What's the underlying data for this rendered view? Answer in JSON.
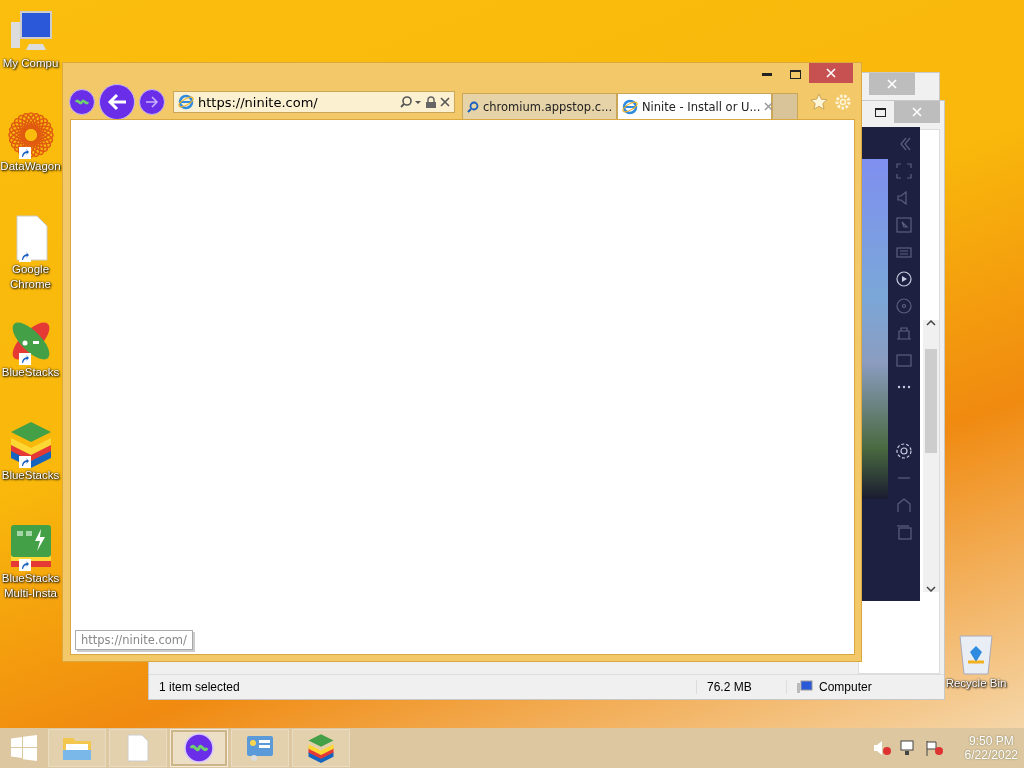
{
  "desktop_icons": [
    {
      "label": "My Compu",
      "kind": "computer",
      "shortcut": false
    },
    {
      "label": "DataWagon",
      "kind": "star",
      "shortcut": true
    },
    {
      "label": "Google Chrome",
      "kind": "file",
      "shortcut": true
    },
    {
      "label": "BlueStacks",
      "kind": "cross",
      "shortcut": true
    },
    {
      "label": "BlueStacks",
      "kind": "stack",
      "shortcut": true
    },
    {
      "label": "BlueStacks Multi-Insta",
      "kind": "multi",
      "shortcut": true
    }
  ],
  "recycle_bin": {
    "label": "Recycle Bin"
  },
  "explorer": {
    "status": "1 item selected",
    "size": "76.2 MB",
    "location": "Computer"
  },
  "browser": {
    "address": "https://ninite.com/",
    "tabs": [
      {
        "label": "chromium.appstop.c...",
        "kind": "search",
        "selected": false
      },
      {
        "label": "Ninite - Install or U...",
        "kind": "ie",
        "selected": true
      }
    ],
    "status_url": "https://ninite.com/"
  },
  "taskbar": {
    "buttons": [
      {
        "kind": "explorer",
        "selected": false
      },
      {
        "kind": "file",
        "selected": false
      },
      {
        "kind": "browser",
        "selected": true
      },
      {
        "kind": "panel",
        "selected": false
      },
      {
        "kind": "stack",
        "selected": false
      }
    ],
    "time": "9:50 PM",
    "date": "6/22/2022"
  }
}
